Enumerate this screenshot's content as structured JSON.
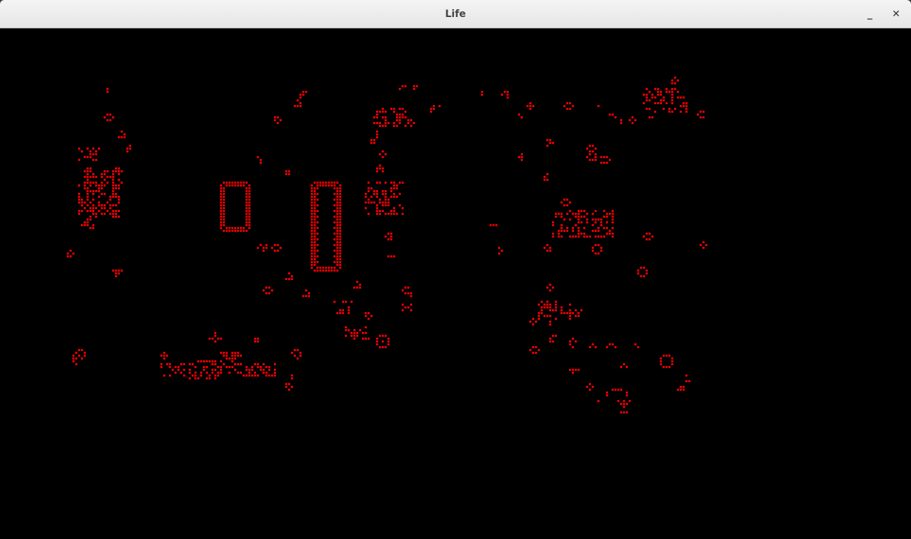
{
  "window": {
    "title": "Life",
    "minimize_label": "_",
    "close_label": "✕"
  },
  "board": {
    "background": "#000000",
    "cell_color": "#e00000"
  }
}
